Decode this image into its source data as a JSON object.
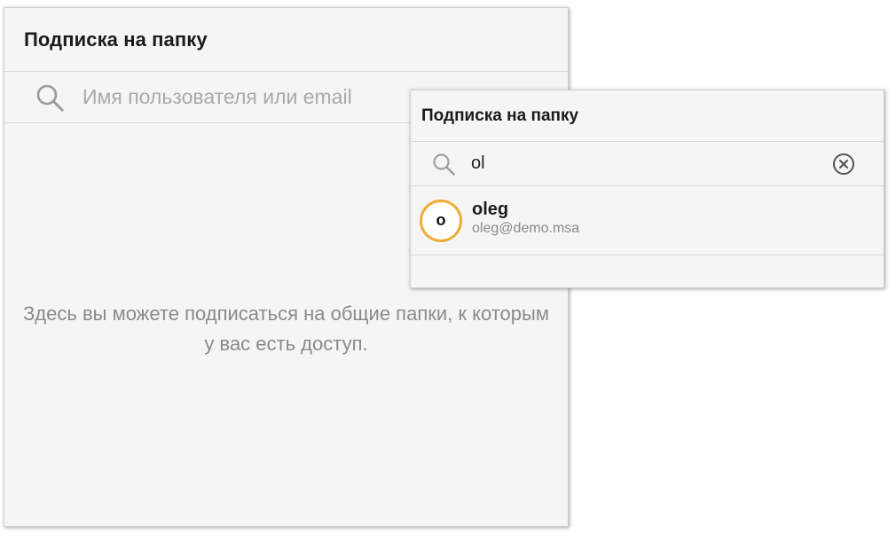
{
  "main_panel": {
    "title": "Подписка на папку",
    "search": {
      "placeholder": "Имя пользователя или email",
      "value": "",
      "icon": "search-icon"
    },
    "empty_message": "Здесь вы можете подписаться на общие папки, к которым у вас есть доступ."
  },
  "popup_panel": {
    "title": "Подписка на папку",
    "search": {
      "placeholder": "",
      "value": "ol",
      "icon": "search-icon",
      "clear_icon": "clear-circle-icon"
    },
    "results": [
      {
        "avatar_initial": "o",
        "name": "oleg",
        "email": "oleg@demo.msa",
        "avatar_ring_color": "#f0ac35"
      }
    ]
  },
  "colors": {
    "panel_bg": "#f5f5f5",
    "divider": "#d9d9d9",
    "muted_text": "#8a8a8a",
    "accent_ring": "#f0ac35"
  }
}
